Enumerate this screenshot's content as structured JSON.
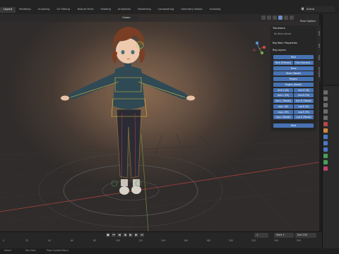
{
  "topbar": {
    "tabs": [
      "Layout",
      "Modeling",
      "Sculpting",
      "UV Editing",
      "Texture Paint",
      "Shading",
      "Animation",
      "Rendering",
      "Compositing",
      "Geometry Nodes",
      "Scripting"
    ],
    "active_tab": "Layout",
    "scene": "Scene"
  },
  "viewport": {
    "orientation": "Global",
    "pose_options": "Pose Options"
  },
  "npanel": {
    "transform": "Transform",
    "no_bones": "No Bone Active",
    "rig_main": "Rig Main Properties",
    "rig_layers": "Rig Layers",
    "buttons": {
      "face": "Face",
      "face_primary": "Face (Primary)",
      "face_secondary": "Face (Second...",
      "torso": "Torso",
      "torso_tweak": "Torso (Tweak)",
      "fingers": "Fingers",
      "fingers_detail": "Fingers (Detail)",
      "arm_l_ik": "Arm.L (IK)",
      "arm_r_ik": "Arm.R (IK)",
      "arm_l_fk": "Arm.L (FK)",
      "arm_r_fk": "Arm.R (FK)",
      "arm_l_tweak": "Arm.L (Tweak)",
      "arm_r_tweak": "Arm.R (Tweak)",
      "leg_l_ik": "Leg.L (IK)",
      "leg_r_ik": "Leg.R (IK)",
      "leg_l_fk": "Leg.L (FK)",
      "leg_r_fk": "Leg.R (FK)",
      "leg_l_tweak": "Leg.L (Tweak)",
      "leg_r_tweak": "Leg.R (Tweak)",
      "root": "Root"
    },
    "side_tabs": [
      "Item",
      "Tool",
      "View",
      "Animation"
    ]
  },
  "timeline": {
    "current_frame": "1",
    "start_label": "Start",
    "start": "1",
    "end_label": "End",
    "end": "250",
    "ruler": [
      "0",
      "20",
      "40",
      "60",
      "80",
      "100",
      "120",
      "140",
      "160",
      "180",
      "200",
      "220",
      "240",
      "250"
    ]
  },
  "status": {
    "left": "Select",
    "middle": "Pan View",
    "right": "Pose Context Menu"
  },
  "colors": {
    "accent": "#4772b3",
    "background": "#1d1d1d",
    "panel": "#262626"
  }
}
